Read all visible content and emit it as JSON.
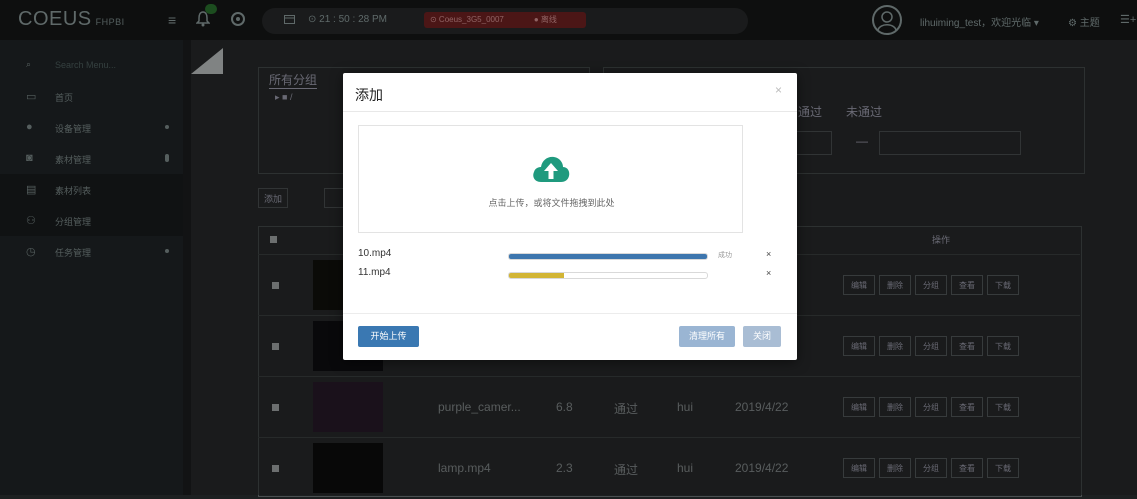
{
  "app": {
    "logo": "COEUS",
    "logo_sub": "FHPBI"
  },
  "topbar": {
    "time": "⊙ 21 : 50 : 28 PM",
    "device_name": "⊙ Coeus_3G5_0007",
    "device_status": "● 离线",
    "user_text": "lihuiming_test，欢迎光临 ▾",
    "theme_label": "⚙ 主题",
    "more_label": "☰+"
  },
  "sidebar": {
    "search_placeholder": "Search Menu...",
    "items": [
      {
        "icon": "monitor-icon",
        "label": "首页"
      },
      {
        "icon": "gear-icon",
        "label": "设备管理"
      },
      {
        "icon": "camera-icon",
        "label": "素材管理"
      },
      {
        "icon": "list-icon",
        "label": "素材列表"
      },
      {
        "icon": "users-icon",
        "label": "分组管理"
      },
      {
        "icon": "clock-icon",
        "label": "任务管理"
      }
    ]
  },
  "main": {
    "group_title": "所有分组",
    "group_root": "▸ ■ /",
    "filter_pass": "通过",
    "filter_fail": "未通过",
    "filter_dash": "—",
    "add_button": "添加",
    "ops_header": "操作",
    "row_ops": [
      "编辑",
      "删除",
      "分组",
      "查看",
      "下载"
    ],
    "rows": [
      {
        "name": "",
        "size": "",
        "status": "",
        "user": "",
        "date": ""
      },
      {
        "name": "",
        "size": "",
        "status": "",
        "user": "",
        "date": ""
      },
      {
        "name": "purple_camer...",
        "size": "6.8",
        "status": "通过",
        "user": "hui",
        "date": "2019/4/22"
      },
      {
        "name": "lamp.mp4",
        "size": "2.3",
        "status": "通过",
        "user": "hui",
        "date": "2019/4/22"
      }
    ]
  },
  "dialog": {
    "title": "添加",
    "close": "×",
    "upload_hint": "点击上传，或将文件拖拽到此处",
    "files": [
      {
        "name": "10.mp4",
        "progress": 1.0,
        "status": "成功",
        "color": "#3d76ae"
      },
      {
        "name": "11.mp4",
        "progress": 0.28,
        "status": "",
        "color": "#d2b535"
      }
    ],
    "remove_label": "×",
    "start_button": "开始上传",
    "clear_button": "清理所有",
    "close_button": "关闭"
  },
  "colors": {
    "accent": "#3a78b2",
    "cloud": "#1f9a7e",
    "offline": "#7a2425"
  }
}
